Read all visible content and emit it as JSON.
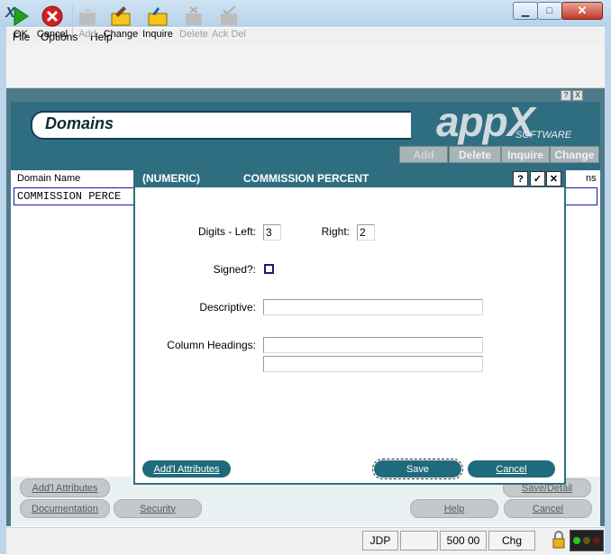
{
  "window": {
    "app_icon": "X",
    "controls": [
      "minimize-icon",
      "maximize-icon",
      "close-icon"
    ]
  },
  "menu": {
    "items": [
      "File",
      "Options",
      "Help"
    ]
  },
  "toolbar": {
    "ok": "OK",
    "cancel": "Cancel",
    "add": "Add",
    "change": "Change",
    "inquire": "Inquire",
    "delete": "Delete",
    "ack_del": "Ack Del"
  },
  "screen": {
    "title": "Domains",
    "logo_text": "appX",
    "logo_subtext": "SOFTWARE",
    "mini_buttons": [
      "?",
      "X"
    ],
    "header_buttons": {
      "add": "Add",
      "delete": "Delete",
      "inquire": "Inquire",
      "change": "Change"
    },
    "column_header": "Domain Name",
    "column_header_right": "ns",
    "selected_row": "COMMISSION PERCE"
  },
  "bottom_buttons": {
    "addl_attributes": "Add'l Attributes",
    "documentation": "Documentation",
    "security": "Security",
    "save_detail": "Save/Detail",
    "help": "Help",
    "cancel": "Cancel"
  },
  "dialog": {
    "type": "(NUMERIC)",
    "title": "COMMISSION PERCENT",
    "controls": [
      "?",
      "✓",
      "✕"
    ],
    "digits_left_label": "Digits - Left:",
    "digits_left_value": "3",
    "right_label": "Right:",
    "right_value": "2",
    "signed_label": "Signed?:",
    "descriptive_label": "Descriptive:",
    "descriptive_value": "",
    "column_headings_label": "Column Headings:",
    "column_heading_1": "",
    "column_heading_2": "",
    "addl_attributes_button": "Add'l Attributes",
    "save_button": "Save",
    "cancel_button": "Cancel"
  },
  "status": {
    "user": "JDP",
    "value": "500 00",
    "mode": "Chg"
  },
  "colors": {
    "teal": "#2f6e80",
    "teal_dark": "#1f6a7c"
  }
}
